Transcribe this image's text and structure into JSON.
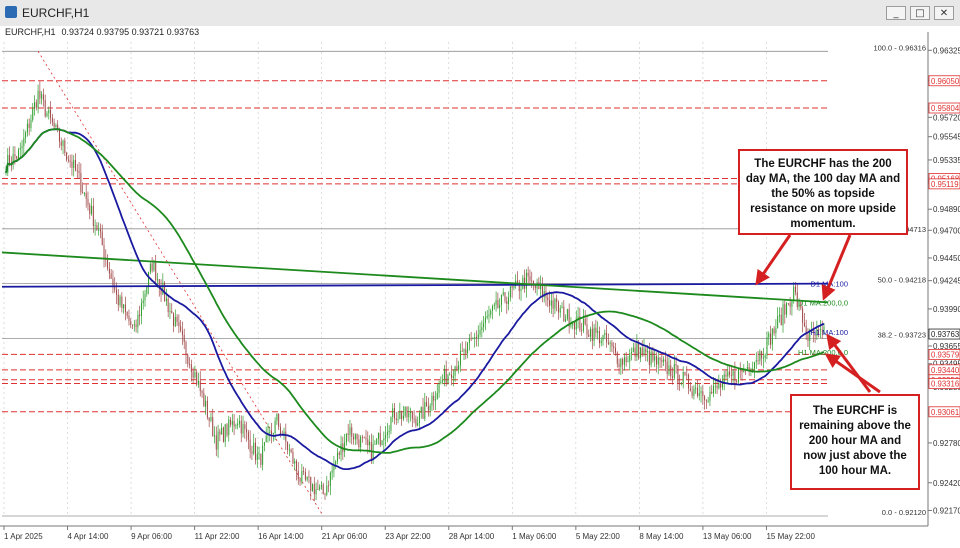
{
  "window": {
    "title": "EURCHF,H1",
    "buttons": [
      "_",
      "□",
      "✕"
    ]
  },
  "chart_data": {
    "type": "candlestick",
    "symbol": "EURCHF,H1",
    "ohlc_text": "0.93724 0.93795 0.93721 0.93763",
    "ylim": [
      0.9212,
      0.964
    ],
    "price_ticks": [
      "0.96325",
      "0.96050",
      "0.95800",
      "0.95720",
      "0.95545",
      "0.95335",
      "0.95140",
      "0.94890",
      "0.94700",
      "0.94450",
      "0.94245",
      "0.93990",
      "0.93750",
      "0.93655",
      "0.93495",
      "0.93285",
      "0.93050",
      "0.92780",
      "0.92420",
      "0.92170"
    ],
    "time_ticks": [
      "1 Apr 2025",
      "4 Apr 14:00",
      "9 Apr 06:00",
      "11 Apr 22:00",
      "16 Apr 14:00",
      "21 Apr 06:00",
      "23 Apr 22:00",
      "28 Apr 14:00",
      "1 May 06:00",
      "5 May 22:00",
      "8 May 14:00",
      "13 May 06:00",
      "15 May 22:00"
    ],
    "price_labels": [
      {
        "text": "0.96050",
        "price": 0.9605,
        "color": "#e03030"
      },
      {
        "text": "0.95804",
        "price": 0.95804,
        "color": "#e03030"
      },
      {
        "text": "0.95168",
        "price": 0.95168,
        "color": "#e03030"
      },
      {
        "text": "0.95119",
        "price": 0.95119,
        "color": "#e03030"
      },
      {
        "text": "0.93763",
        "price": 0.93763,
        "color": "#222222"
      },
      {
        "text": "0.93579",
        "price": 0.93579,
        "color": "#e03030"
      },
      {
        "text": "0.93440",
        "price": 0.9344,
        "color": "#e03030"
      },
      {
        "text": "0.93350",
        "price": 0.9335,
        "color": "#e03030"
      },
      {
        "text": "0.93316",
        "price": 0.93316,
        "color": "#e03030"
      },
      {
        "text": "0.93061",
        "price": 0.93061,
        "color": "#e03030"
      }
    ],
    "red_levels": [
      0.9605,
      0.95804,
      0.95168,
      0.95119,
      0.93579,
      0.9344,
      0.9335,
      0.93316,
      0.93061
    ],
    "fib_levels": [
      {
        "label": "100.0 - 0.96316",
        "price": 0.96316
      },
      {
        "label": "50.0 - 0.94218",
        "price": 0.94218
      },
      {
        "label": "38.2 - 0.93723",
        "price": 0.93723
      },
      {
        "label": "0.0 - 0.92120",
        "price": 0.9212
      }
    ],
    "extra_level": {
      "text": "0.94713",
      "price": 0.94713
    },
    "ma_labels": [
      {
        "label": "D1 MA:100",
        "price": 0.94218,
        "color": "#1a1aa0"
      },
      {
        "label": "D1 MA:200,0,0",
        "price": 0.94049,
        "color": "#1d8a1d"
      },
      {
        "label": "H1 MA:100",
        "price": 0.9378,
        "color": "#1a1aa0"
      },
      {
        "label": "H1 MA:200,0,0",
        "price": 0.93602,
        "color": "#1d8a1d"
      }
    ],
    "ma_values": {
      "d1_ma100": 0.94218,
      "d1_ma200": 0.94049,
      "h1_ma200": 0.93602,
      "last_price": 0.93763
    },
    "colors": {
      "red_level": "#e03030",
      "blue_ma": "#1a1aa0",
      "green_ma": "#1d8a1d",
      "bull": "#2e9e2e",
      "bear": "#a04848",
      "grid": "#c8c8c8"
    }
  },
  "annotations": {
    "top_note": "The EURCHF has the 200 day MA, the 100 day MA and the 50% as topside resistance on more upside momentum.",
    "bottom_note": "The EURCHF is remaining above the 200 hour MA and now just above the 100 hour MA."
  }
}
